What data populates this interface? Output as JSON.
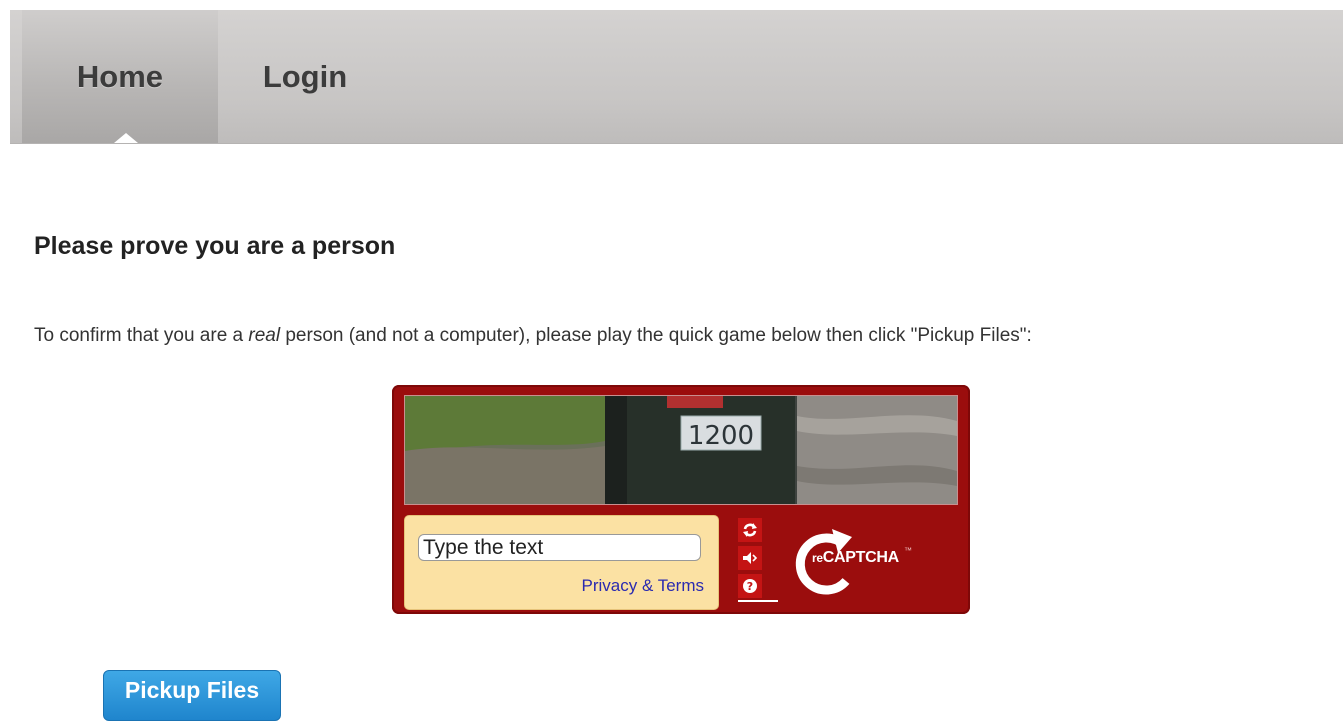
{
  "nav": {
    "tabs": [
      {
        "label": "Home",
        "active": true
      },
      {
        "label": "Login",
        "active": false
      }
    ]
  },
  "main": {
    "heading": "Please prove you are a person",
    "intro": {
      "before": "To confirm that you are a ",
      "emphasis": "real",
      "after": " person (and not a computer), please play the quick game below then click \"Pickup Files\":"
    }
  },
  "captcha": {
    "image_text": "1200",
    "input_placeholder": "Type the text",
    "input_value": "",
    "privacy_label": "Privacy & Terms",
    "controls": [
      "refresh-icon",
      "audio-icon",
      "help-icon"
    ],
    "brand_prefix": "re",
    "brand_name": "CAPTCHA",
    "brand_tm": "™",
    "colors": {
      "frame": "#9b0d0d",
      "panel": "#fbe1a3",
      "button": "#c41414",
      "link": "#2a2ab0"
    }
  },
  "submit": {
    "label": "Pickup Files",
    "color": "#1f85cd"
  }
}
